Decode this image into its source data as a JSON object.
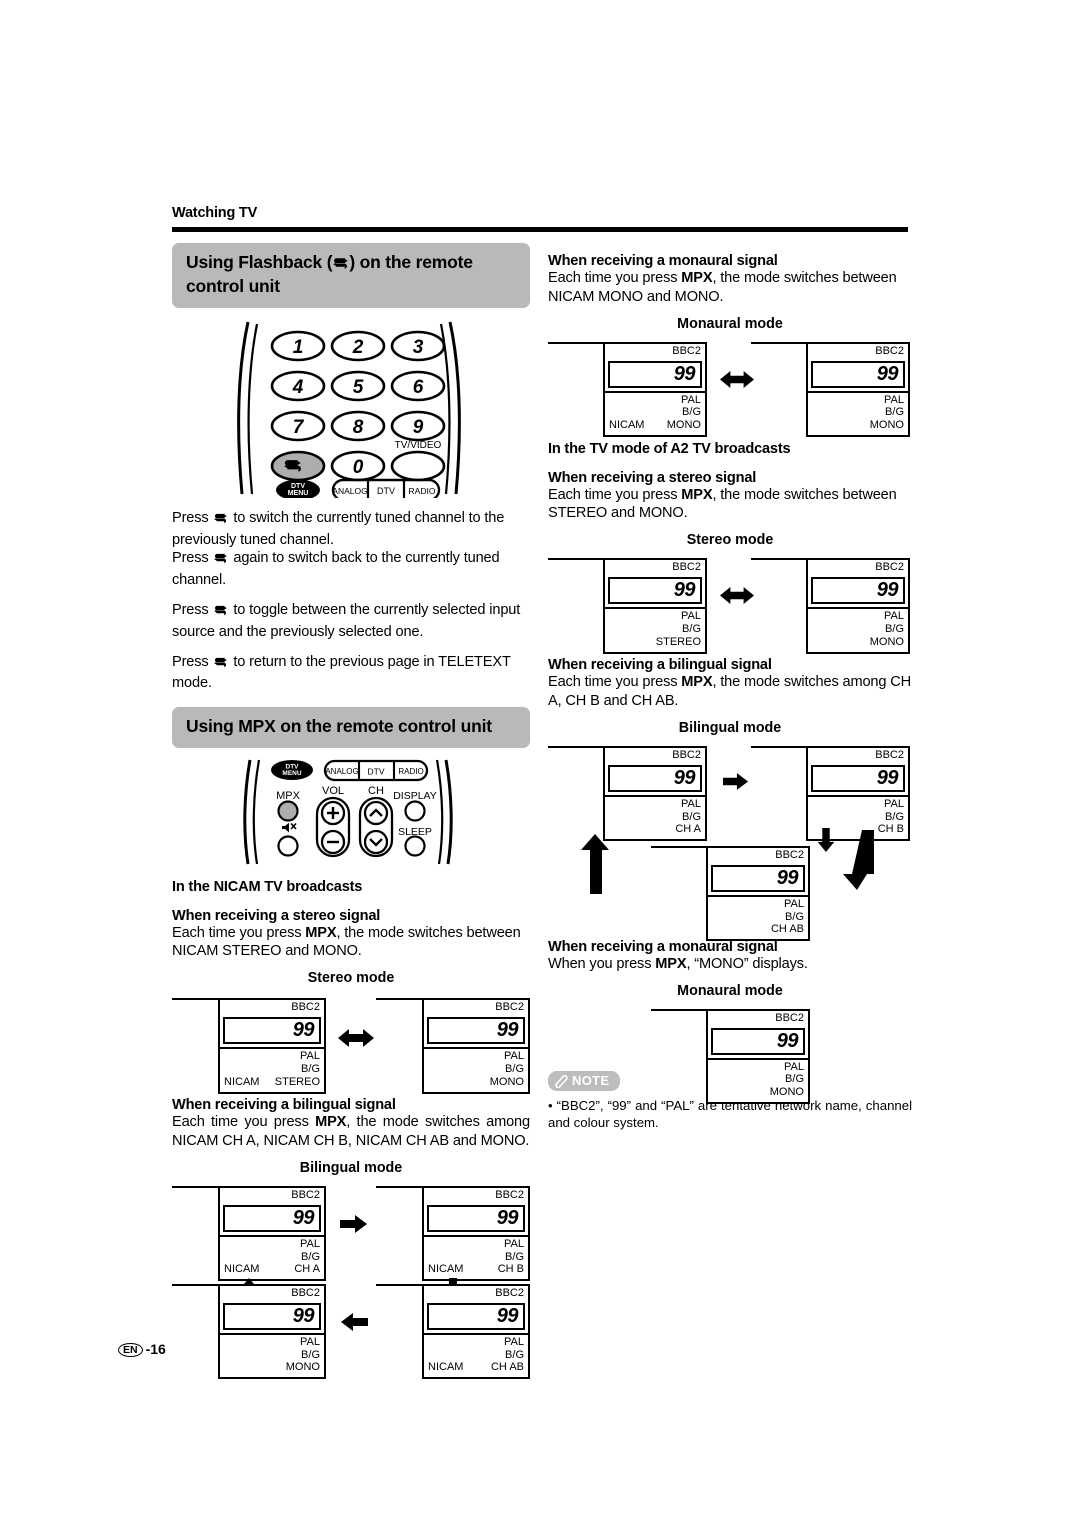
{
  "page": {
    "running_head": "Watching TV",
    "footer_region": "EN",
    "footer_page": "-16"
  },
  "left": {
    "section1": {
      "title_pre": "Using Flashback (",
      "title_post": ") on the remote control unit",
      "icon": "flashback-icon",
      "remote": {
        "keys": [
          "1",
          "2",
          "3",
          "4",
          "5",
          "6",
          "7",
          "8",
          "9"
        ],
        "flashback_key": "flashback-icon",
        "zero_key": "0",
        "tvvideo_label": "TV/VIDEO",
        "dtv_menu_line1": "DTV",
        "dtv_menu_line2": "MENU",
        "mode_buttons": [
          "ANALOG",
          "DTV",
          "RADIO"
        ]
      },
      "paragraphs": [
        {
          "pre": "Press ",
          "post": " to switch the currently tuned channel to the previously tuned channel."
        },
        {
          "pre": "Press ",
          "post": " again to switch back to the currently tuned channel."
        },
        {
          "pre": "Press ",
          "post": " to toggle between the currently selected input source and the previously selected one."
        },
        {
          "pre": "Press ",
          "post": " to return to the previous page in TELETEXT mode."
        }
      ]
    },
    "section2": {
      "title": "Using MPX on the remote control unit",
      "remote": {
        "dtv_menu_line1": "DTV",
        "dtv_menu_line2": "MENU",
        "mode_buttons": [
          "ANALOG",
          "DTV",
          "RADIO"
        ],
        "mpx_label": "MPX",
        "vol_label": "VOL",
        "ch_label": "CH",
        "display_label": "DISPLAY",
        "sleep_label": "SLEEP",
        "mute_icon": "mute-icon",
        "vol_plus": "+",
        "vol_minus": "−",
        "ch_up": "⌃",
        "ch_down": "⌄"
      },
      "heading": "In the NICAM TV broadcasts",
      "stereo": {
        "heading": "When receiving a stereo signal",
        "body_pre": "Each time you press ",
        "body_bold": "MPX",
        "body_post": ", the mode switches between NICAM STEREO and MONO.",
        "caption": "Stereo mode",
        "panels": [
          {
            "net": "BBC2",
            "num": "99",
            "sys": "PAL",
            "band": "B/G",
            "left": "NICAM",
            "mode": "STEREO"
          },
          {
            "net": "BBC2",
            "num": "99",
            "sys": "PAL",
            "band": "B/G",
            "left": "",
            "mode": "MONO"
          }
        ],
        "arrow": "double-arrow-icon"
      },
      "bilingual": {
        "heading": "When receiving a bilingual signal",
        "body_pre": "Each time you press ",
        "body_bold": "MPX",
        "body_post": ", the mode switches among NICAM CH A, NICAM CH B, NICAM CH AB and MONO.",
        "caption": "Bilingual mode",
        "panels": [
          {
            "net": "BBC2",
            "num": "99",
            "sys": "PAL",
            "band": "B/G",
            "left": "NICAM",
            "mode": "CH A"
          },
          {
            "net": "BBC2",
            "num": "99",
            "sys": "PAL",
            "band": "B/G",
            "left": "NICAM",
            "mode": "CH B"
          },
          {
            "net": "BBC2",
            "num": "99",
            "sys": "PAL",
            "band": "B/G",
            "left": "",
            "mode": "MONO"
          },
          {
            "net": "BBC2",
            "num": "99",
            "sys": "PAL",
            "band": "B/G",
            "left": "NICAM",
            "mode": "CH AB"
          }
        ],
        "arrows": [
          "arrow-right-icon",
          "arrow-down-icon",
          "arrow-left-icon",
          "arrow-up-icon"
        ]
      }
    }
  },
  "right": {
    "nicam_monaural": {
      "heading": "When receiving a monaural signal",
      "body_pre": "Each time you press ",
      "body_bold": "MPX",
      "body_post": ", the mode switches between NICAM MONO and MONO.",
      "caption": "Monaural mode",
      "panels": [
        {
          "net": "BBC2",
          "num": "99",
          "sys": "PAL",
          "band": "B/G",
          "left": "NICAM",
          "mode": "MONO"
        },
        {
          "net": "BBC2",
          "num": "99",
          "sys": "PAL",
          "band": "B/G",
          "left": "",
          "mode": "MONO"
        }
      ],
      "arrow": "double-arrow-icon"
    },
    "a2_heading": "In the TV mode of A2 TV broadcasts",
    "a2_stereo": {
      "heading": "When receiving a stereo signal",
      "body_pre": "Each time you press ",
      "body_bold": "MPX",
      "body_post": ", the mode switches between STEREO and MONO.",
      "caption": "Stereo mode",
      "panels": [
        {
          "net": "BBC2",
          "num": "99",
          "sys": "PAL",
          "band": "B/G",
          "left": "",
          "mode": "STEREO"
        },
        {
          "net": "BBC2",
          "num": "99",
          "sys": "PAL",
          "band": "B/G",
          "left": "",
          "mode": "MONO"
        }
      ],
      "arrow": "double-arrow-icon"
    },
    "a2_bilingual": {
      "heading": "When receiving a bilingual signal",
      "body_pre": "Each time you press ",
      "body_bold": "MPX",
      "body_post": ", the mode switches among CH A, CH B and CH AB.",
      "caption": "Bilingual mode",
      "panels": [
        {
          "net": "BBC2",
          "num": "99",
          "sys": "PAL",
          "band": "B/G",
          "left": "",
          "mode": "CH A"
        },
        {
          "net": "BBC2",
          "num": "99",
          "sys": "PAL",
          "band": "B/G",
          "left": "",
          "mode": "CH B"
        },
        {
          "net": "BBC2",
          "num": "99",
          "sys": "PAL",
          "band": "B/G",
          "left": "",
          "mode": "CH AB"
        }
      ],
      "arrows": [
        "arrow-right-icon",
        "arrow-down-icon",
        "loop-arrow-icon"
      ]
    },
    "a2_monaural": {
      "heading": "When receiving a monaural signal",
      "body_pre": "When you press ",
      "body_bold": "MPX",
      "body_post": ", “MONO” displays.",
      "caption": "Monaural mode",
      "panels": [
        {
          "net": "BBC2",
          "num": "99",
          "sys": "PAL",
          "band": "B/G",
          "left": "",
          "mode": "MONO"
        }
      ]
    },
    "note": {
      "badge": "NOTE",
      "badge_icon": "note-pencil-icon",
      "bullet": "•",
      "text": "“BBC2”, “99” and “PAL” are tentative network name, channel and colour system."
    }
  }
}
